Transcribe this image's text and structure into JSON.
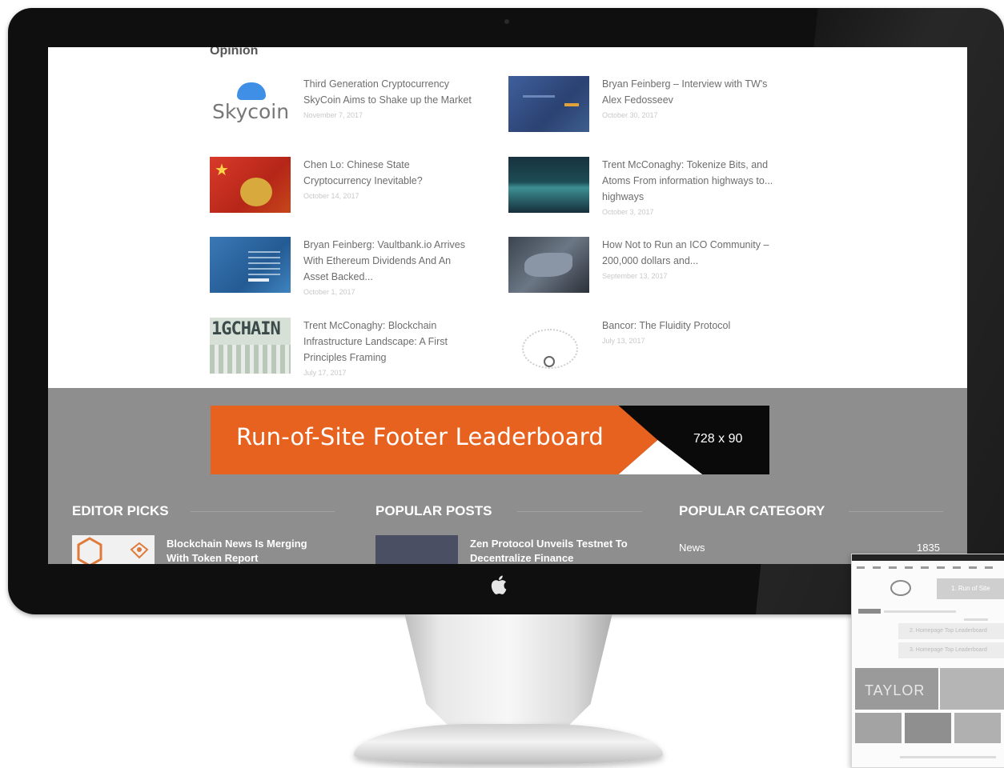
{
  "screen": {
    "section_heading": "Opinion",
    "articles": [
      {
        "title": "Third Generation Cryptocurrency SkyCoin Aims to Shake up the Market",
        "date": "November 7, 2017",
        "thumb": "Skycoin"
      },
      {
        "title": "Bryan Feinberg – Interview with TW's Alex Fedosseev",
        "date": "October 30, 2017"
      },
      {
        "title": "Chen Lo: Chinese State Cryptocurrency Inevitable?",
        "date": "October 14, 2017"
      },
      {
        "title": "Trent McConaghy: Tokenize Bits, and Atoms From information highways to... highways",
        "date": "October 3, 2017"
      },
      {
        "title": "Bryan Feinberg: Vaultbank.io Arrives With Ethereum Dividends And An Asset Backed...",
        "date": "October 1, 2017"
      },
      {
        "title": "How Not to Run an ICO Community – 200,000 dollars and...",
        "date": "September 13, 2017"
      },
      {
        "title": "Trent McConaghy: Blockchain Infrastructure Landscape: A First Principles Framing",
        "date": "July 17, 2017",
        "thumb": "1GCHAIN"
      },
      {
        "title": "Bancor: The Fluidity Protocol",
        "date": "July 13, 2017"
      }
    ],
    "leaderboard": {
      "label": "Run-of-Site Footer Leaderboard",
      "size": "728 x 90"
    },
    "footer": {
      "editor_picks": {
        "heading": "EDITOR PICKS",
        "item_title": "Blockchain News Is Merging With Token Report"
      },
      "popular_posts": {
        "heading": "POPULAR POSTS",
        "item_title": "Zen Protocol Unveils Testnet To Decentralize Finance"
      },
      "popular_category": {
        "heading": "POPULAR CATEGORY",
        "item_name": "News",
        "item_count": "1835"
      }
    }
  },
  "mini_screenshot": {
    "banner_label": "1. Run of Site",
    "box1_label": "2. Homepage Top Leaderboard",
    "box2_label": "3. Homepage Top Leaderboard",
    "hero_label": "TAYLOR"
  },
  "colors": {
    "accent_orange": "#e8621f",
    "footer_gray": "#8e8e8e",
    "bezel": "#0f0f0f"
  }
}
